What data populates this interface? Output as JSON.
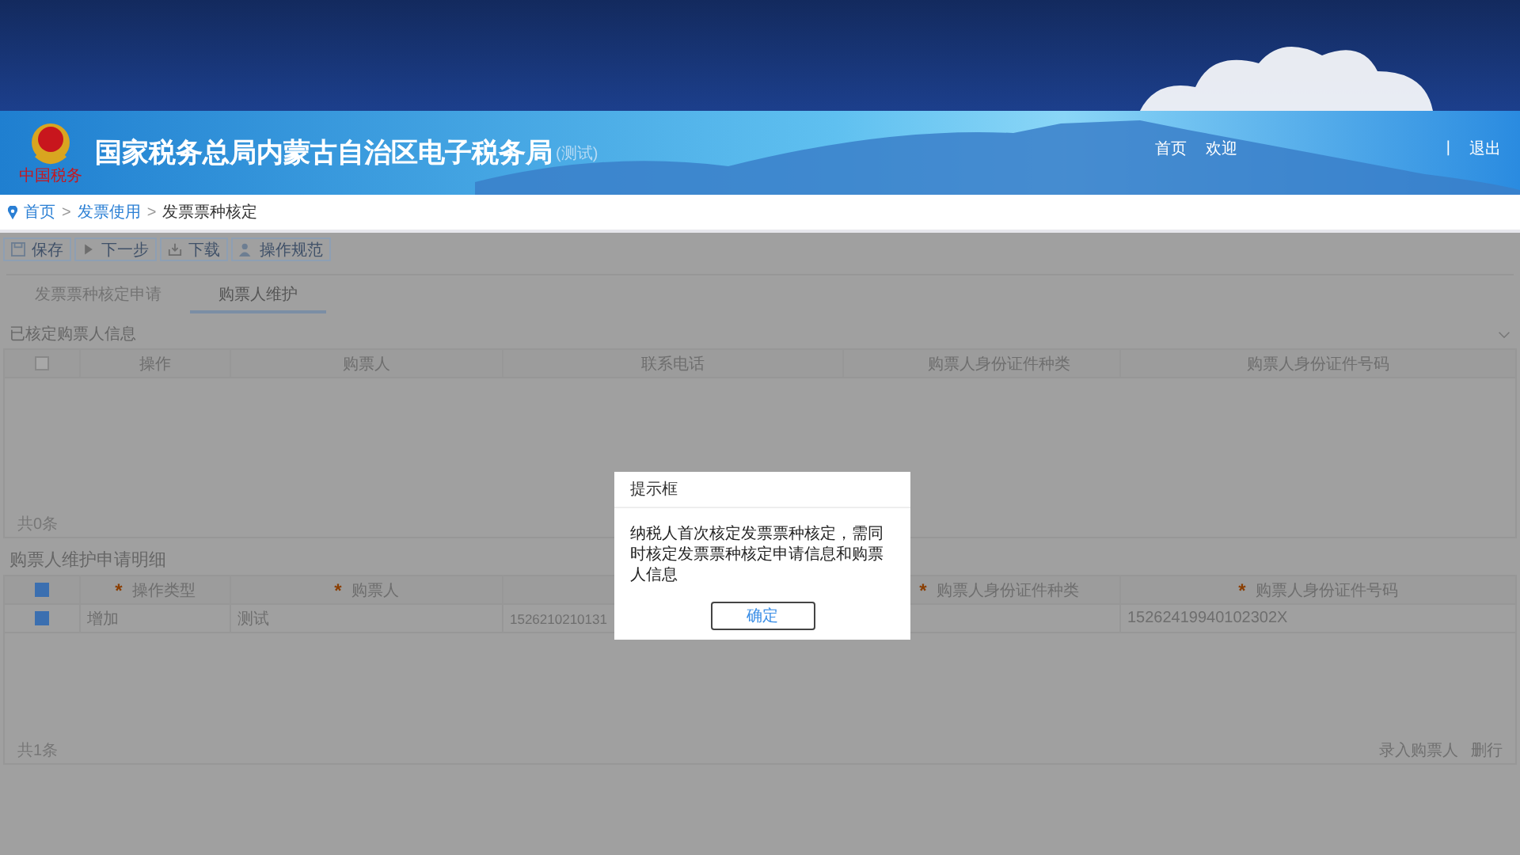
{
  "header": {
    "logo_caption": "中国税务",
    "title": "国家税务总局内蒙古自治区电子税务局",
    "title_note": "(测试)",
    "links": [
      "首页",
      "欢迎"
    ],
    "separator": "|",
    "logout": "退出"
  },
  "breadcrumb": {
    "items": [
      "首页",
      "发票使用",
      "发票票种核定"
    ],
    "separator": ">"
  },
  "toolbar": [
    {
      "label": "保存",
      "kind": "save"
    },
    {
      "label": "下一步",
      "kind": "next"
    },
    {
      "label": "下载",
      "kind": "download"
    },
    {
      "label": "操作规范",
      "kind": "guide"
    }
  ],
  "tabs": [
    {
      "label": "发票票种核定申请",
      "selected": false
    },
    {
      "label": "购票人维护",
      "selected": true
    }
  ],
  "approved": {
    "title": "已核定购票人信息",
    "select_all_checked": false,
    "columns": [
      "操作",
      "购票人",
      "联系电话",
      "购票人身份证件种类",
      "购票人身份证件号码"
    ],
    "footer": "共0条"
  },
  "details": {
    "title": "购票人维护申请明细",
    "select_all_checked": true,
    "columns": [
      {
        "marker": "*",
        "label": "操作类型"
      },
      {
        "marker": "*",
        "label": "购票人"
      },
      null,
      {
        "marker": "*",
        "label": "购票人身份证件种类"
      },
      {
        "marker": "*",
        "label": "购票人身份证件号码"
      }
    ],
    "rows": [
      {
        "checked": true,
        "cells": [
          "增加",
          "测试",
          "1526210210131",
          null,
          "15262419940102302X"
        ]
      }
    ],
    "footer": "共1条",
    "actions": [
      "录入购票人",
      "删行"
    ]
  },
  "dialog": {
    "title": "提示框",
    "message": "纳税人首次核定发票票种核定，需同时核定发票票种核定申请信息和购票人信息",
    "button": "确定"
  }
}
